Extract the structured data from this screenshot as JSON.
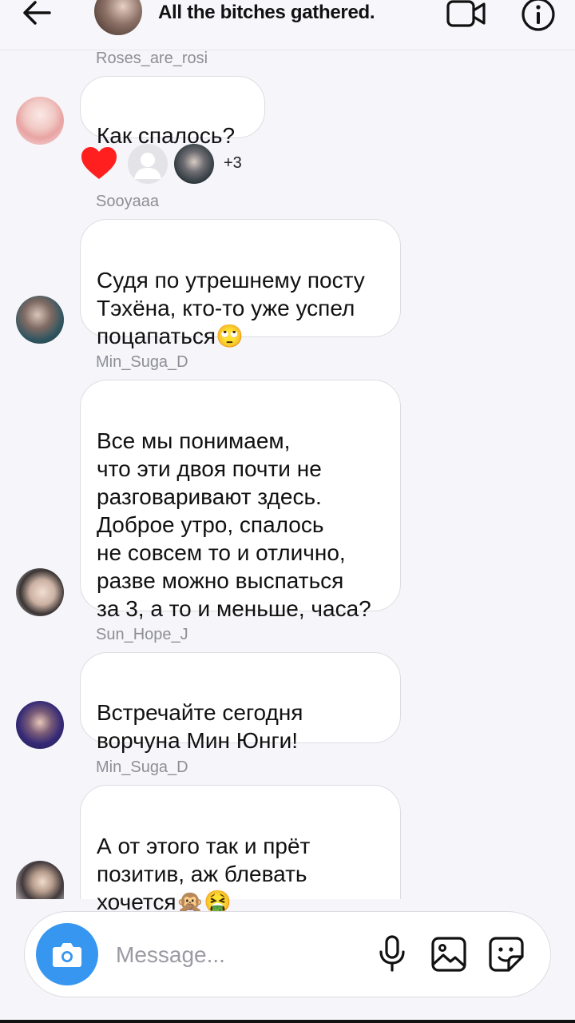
{
  "header": {
    "title": "All the bitches gathered."
  },
  "messages": [
    {
      "sender": "Roses_are_rosi",
      "text": "Как спалось?"
    },
    {
      "sender": "Sooyaaa",
      "text": "Судя по утрешнему посту\nТэхёна, кто-то уже успел\nпоцапаться",
      "emoji": "🙄"
    },
    {
      "sender": "Min_Suga_D",
      "text": "Все мы понимаем,\nчто эти двоя почти не\nразговаривают здесь.\nДоброе утро, спалось\nне совсем то и отлично,\nразве можно выспаться\nза 3, а то и меньше, часа?"
    },
    {
      "sender": "Sun_Hope_J",
      "text": "Встречайте сегодня\nворчуна Мин Юнги!"
    },
    {
      "sender": "Min_Suga_D",
      "text": "А от этого так и прёт\nпозитив, аж блевать\nхочется",
      "emoji": "🙊🤮"
    }
  ],
  "reactions": {
    "count_label": "+3",
    "heart_color": "#ff3040"
  },
  "composer": {
    "placeholder": "Message..."
  },
  "colors": {
    "accent": "#3797f0",
    "background": "#f5f5fa",
    "bubble": "#ffffff"
  },
  "icons": [
    "back-arrow-icon",
    "video-call-icon",
    "info-icon",
    "heart-icon",
    "camera-icon",
    "microphone-icon",
    "gallery-icon",
    "sticker-icon"
  ]
}
